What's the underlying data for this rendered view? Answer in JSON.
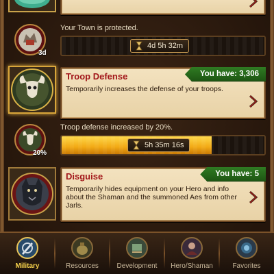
{
  "item1": {
    "status_text": "Your Town is protected.",
    "timer": "4d 5h 32m",
    "badge": "3d",
    "icon": "shield-icon"
  },
  "item2": {
    "title": "Troop Defense",
    "have_label": "You have:",
    "have_count": "3,306",
    "description": "Temporarily increases the defense of your troops.",
    "status_text": "Troop defense increased by 20%.",
    "timer": "5h 35m 16s",
    "badge": "20%",
    "progress": 0.74,
    "icon": "bull-skull-shield-icon"
  },
  "item3": {
    "title": "Disguise",
    "have_label": "You have:",
    "have_count": "5",
    "description": "Temporarily hides equipment on your Hero and info about the Shaman and the summoned Aes from other Jarls.",
    "icon": "wolf-cloak-icon"
  },
  "tabs": [
    {
      "label": "Military",
      "icon": "sword-shield-icon",
      "active": true
    },
    {
      "label": "Resources",
      "icon": "resource-sack-icon",
      "active": false
    },
    {
      "label": "Development",
      "icon": "build-icon",
      "active": false
    },
    {
      "label": "Hero/Shaman",
      "icon": "hero-icon",
      "active": false
    },
    {
      "label": "Favorites",
      "icon": "favorites-icon",
      "active": false
    }
  ],
  "colors": {
    "title_red": "#a2161a",
    "have_green": "#2f7b22",
    "bar_gold": "#f2a914",
    "tab_active": "#f6d24c"
  }
}
